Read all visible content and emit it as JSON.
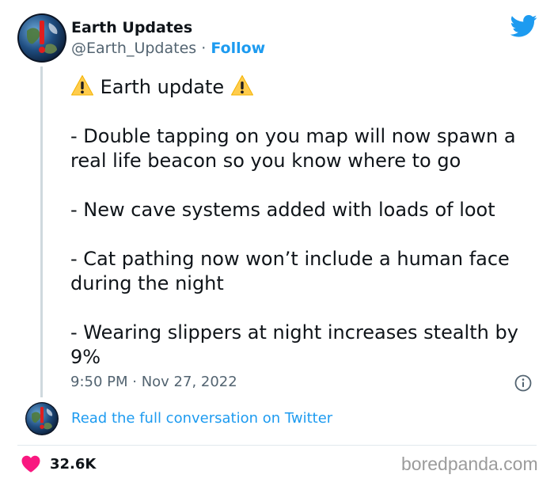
{
  "author": {
    "display_name": "Earth Updates",
    "handle": "@Earth_Updates",
    "separator": "·",
    "follow_label": "Follow"
  },
  "tweet": {
    "heading": "Earth update",
    "lines": [
      "- Double tapping on you map will now spawn a real life beacon so you know where to go",
      "- New cave systems added with loads of loot",
      "- Cat pathing now won’t include a human face during the night",
      "- Wearing slippers at night increases stealth by 9%"
    ],
    "timestamp": "9:50 PM · Nov 27, 2022"
  },
  "conversation_link": "Read the full conversation on Twitter",
  "likes": {
    "count": "32.6K"
  },
  "watermark": "boredpanda.com",
  "colors": {
    "accent": "#1d9bf0",
    "like": "#f91880",
    "secondary_text": "#536471",
    "warning": "#ffcc4d"
  },
  "icons": {
    "brand": "twitter-bird-icon",
    "heading_decoration": "warning-emoji-icon",
    "info": "info-icon",
    "like": "heart-icon"
  }
}
